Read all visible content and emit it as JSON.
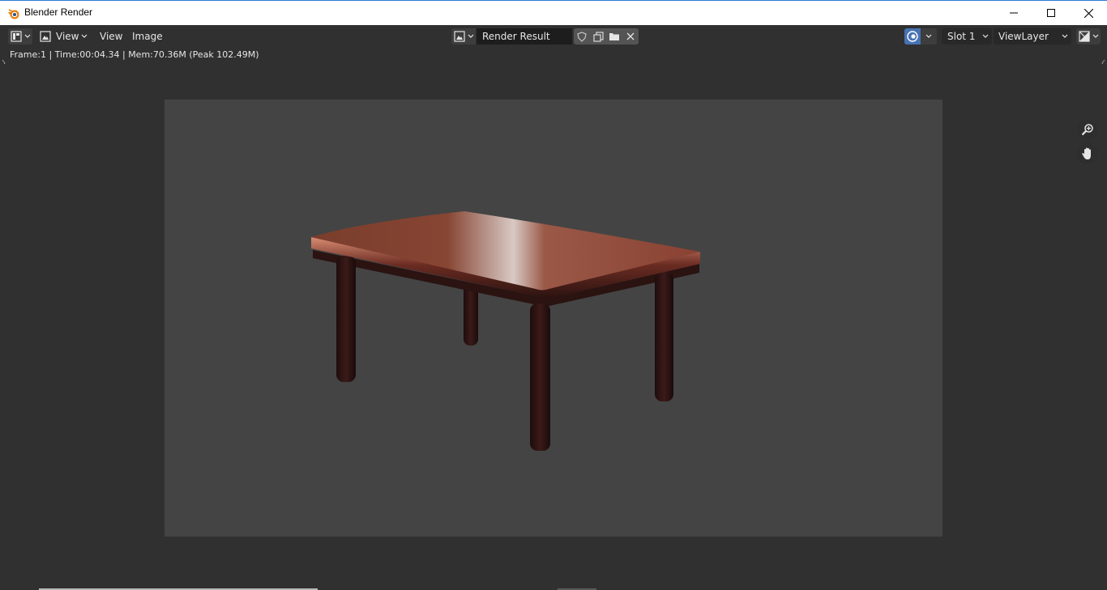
{
  "window": {
    "title": "Blender Render",
    "app_icon": "blender-logo-icon",
    "controls": [
      "minimize-icon",
      "maximize-icon",
      "close-icon"
    ]
  },
  "header": {
    "editor_type_icon": "image-editor-icon",
    "view_dropdown_label": "View",
    "menus": {
      "view": "View",
      "image": "Image"
    },
    "image_name": "Render Result",
    "image_buttons": [
      "fake-user-shield-icon",
      "new-image-icon",
      "open-folder-icon",
      "unlink-x-icon"
    ],
    "render_slot_icon": "render-result-icon",
    "slot": "Slot 1",
    "view_layer": "ViewLayer",
    "display_mode_icon": "display-channels-icon"
  },
  "status": {
    "info": "Frame:1 | Time:00:04.34 | Mem:70.36M (Peak 102.49M)"
  },
  "viewport": {
    "render_subject": "table-render",
    "navigation": [
      "zoom-icon",
      "pan-hand-icon"
    ]
  },
  "colors": {
    "background": "#303030",
    "render_background": "#444444",
    "table_wood": "#7a3a2c",
    "accent": "#4772b3"
  }
}
